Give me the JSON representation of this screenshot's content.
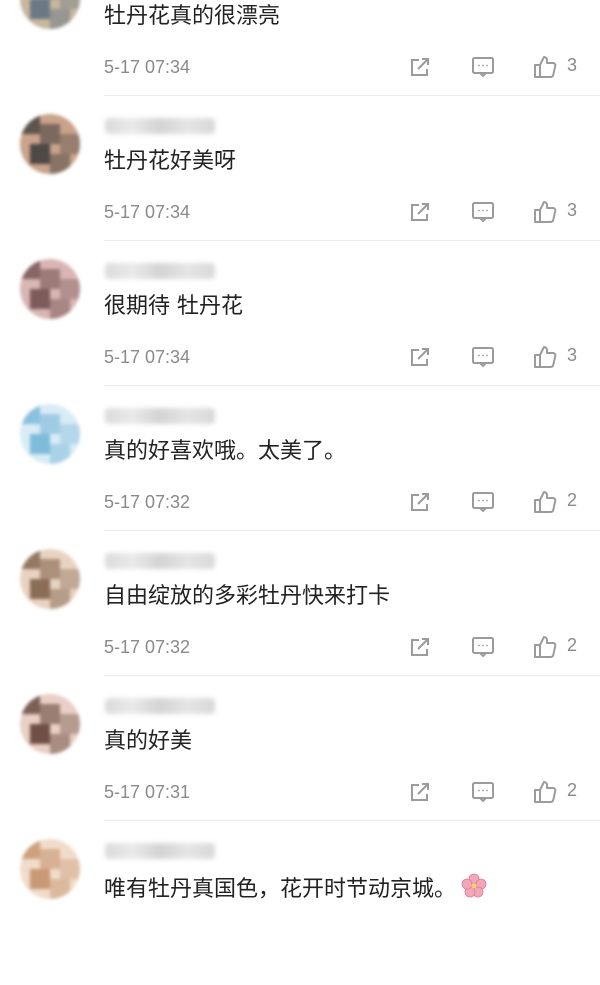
{
  "comments": [
    {
      "text": "牡丹花真的很漂亮",
      "time": "5-17 07:34",
      "likes": "3",
      "avatar_colors": [
        "#5b6f80",
        "#c8b79f"
      ]
    },
    {
      "text": "牡丹花好美呀",
      "time": "5-17 07:34",
      "likes": "3",
      "avatar_colors": [
        "#3a3a3a",
        "#c9a38a"
      ]
    },
    {
      "text": "很期待 牡丹花",
      "time": "5-17 07:34",
      "likes": "3",
      "avatar_colors": [
        "#6b4b4b",
        "#d9b6b3"
      ]
    },
    {
      "text": "真的好喜欢哦。太美了。",
      "time": "5-17 07:32",
      "likes": "2",
      "avatar_colors": [
        "#6fb3d6",
        "#d9ecf5"
      ]
    },
    {
      "text": "自由绽放的多彩牡丹快来打卡",
      "time": "5-17 07:32",
      "likes": "2",
      "avatar_colors": [
        "#7a5a44",
        "#e8d3c2"
      ]
    },
    {
      "text": "真的好美",
      "time": "5-17 07:31",
      "likes": "2",
      "avatar_colors": [
        "#5a3a2f",
        "#e9cfc6"
      ]
    },
    {
      "text": "唯有牡丹真国色，花开时节动京城。",
      "time": "",
      "likes": "",
      "emoji": "cherry-blossom",
      "avatar_colors": [
        "#c28d66",
        "#f1dccb"
      ]
    }
  ],
  "colors": {
    "text": "#222222",
    "meta": "#8a8a8a",
    "icon": "#9b9b9b",
    "divider": "#ececec",
    "blossom": "#f2a7b8"
  }
}
